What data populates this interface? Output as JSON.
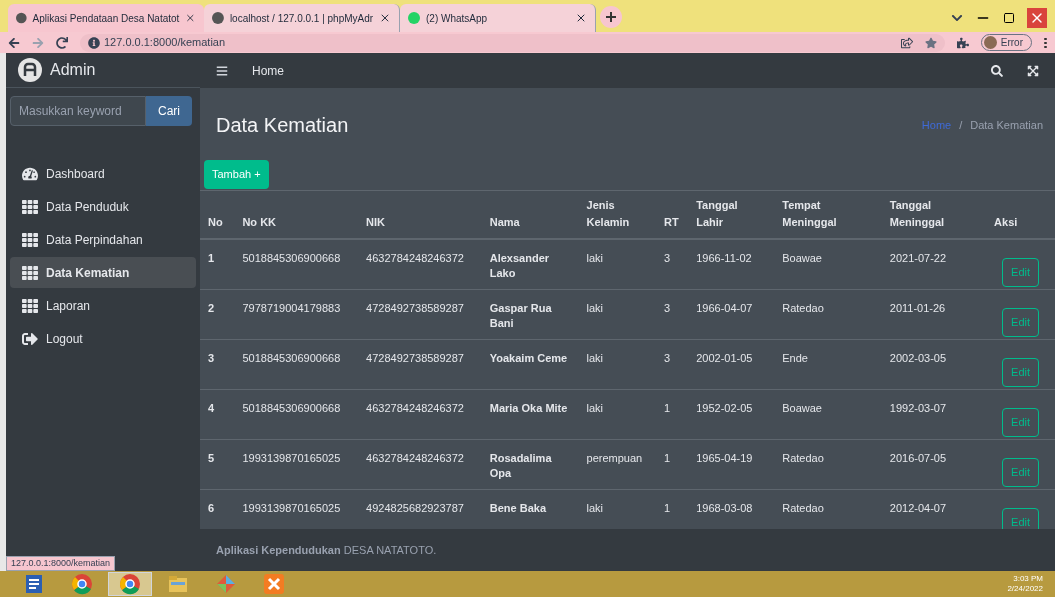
{
  "browser": {
    "tabs": [
      {
        "title": "Aplikasi Pendataan Desa Natatot",
        "selected": true
      },
      {
        "title": "localhost / 127.0.0.1 | phpMyAdr",
        "selected": false
      },
      {
        "title": "(2) WhatsApp",
        "selected": false
      }
    ],
    "url": "127.0.0.1:8000/kematian",
    "profile_label": "Error",
    "status_url": "127.0.0.1:8000/kematian"
  },
  "sidebar": {
    "brand": "Admin",
    "search": {
      "placeholder": "Masukkan keyword"
    },
    "search_button": "Cari",
    "items": [
      {
        "label": "Dashboard",
        "kind": "dashboard",
        "selected": false
      },
      {
        "label": "Data Penduduk",
        "kind": "grid",
        "selected": false
      },
      {
        "label": "Data Perpindahan",
        "kind": "grid",
        "selected": false
      },
      {
        "label": "Data Kematian",
        "kind": "grid",
        "selected": true
      },
      {
        "label": "Laporan",
        "kind": "grid",
        "selected": false
      },
      {
        "label": "Logout",
        "kind": "logout",
        "selected": false
      }
    ]
  },
  "navbar": {
    "home_link": "Home"
  },
  "content": {
    "title": "Data Kematian",
    "breadcrumb_separator": "/",
    "breadcrumb": [
      {
        "label": "Home",
        "link": true
      },
      {
        "label": "Data Kematian",
        "link": false
      }
    ],
    "add_button": "Tambah +",
    "table": {
      "columns": [
        "No",
        "No KK",
        "NIK",
        "Nama",
        "Jenis Kelamin",
        "RT",
        "Tanggal Lahir",
        "Tempat Meninggal",
        "Tanggal Meninggal",
        "Aksi"
      ],
      "rows": [
        {
          "cells": [
            "1",
            "5018845306900668",
            "4632784248246372",
            "Alexsander Lako",
            "laki",
            "3",
            "1966-11-02",
            "Boawae",
            "2021-07-22"
          ],
          "action": "Edit"
        },
        {
          "cells": [
            "2",
            "7978719004179883",
            "4728492738589287",
            "Gaspar Rua Bani",
            "laki",
            "3",
            "1966-04-07",
            "Ratedao",
            "2011-01-26"
          ],
          "action": "Edit"
        },
        {
          "cells": [
            "3",
            "5018845306900668",
            "4728492738589287",
            "Yoakaim Ceme",
            "laki",
            "3",
            "2002-01-05",
            "Ende",
            "2002-03-05"
          ],
          "action": "Edit"
        },
        {
          "cells": [
            "4",
            "5018845306900668",
            "4632784248246372",
            "Maria Oka Mite",
            "laki",
            "1",
            "1952-02-05",
            "Boawae",
            "1992-03-07"
          ],
          "action": "Edit"
        },
        {
          "cells": [
            "5",
            "1993139870165025",
            "4632784248246372",
            "Rosadalima Opa",
            "perempuan",
            "1",
            "1965-04-19",
            "Ratedao",
            "2016-07-05"
          ],
          "action": "Edit"
        },
        {
          "cells": [
            "6",
            "1993139870165025",
            "4924825682923787",
            "Bene Baka",
            "laki",
            "1",
            "1968-03-08",
            "Ratedao",
            "2012-04-07"
          ],
          "action": "Edit"
        }
      ]
    }
  },
  "footer": "**Aplikasi Kependudukan** DESA NATATOTO.",
  "taskbar": {
    "apps": [
      {
        "kind": "word",
        "selected": false
      },
      {
        "kind": "chrome",
        "selected": false
      },
      {
        "kind": "chrome",
        "selected": true
      },
      {
        "kind": "folder",
        "selected": false
      },
      {
        "kind": "diamond",
        "selected": false
      },
      {
        "kind": "xampp",
        "selected": false
      }
    ],
    "time": "3:03 PM",
    "date": "2/24/2022"
  }
}
